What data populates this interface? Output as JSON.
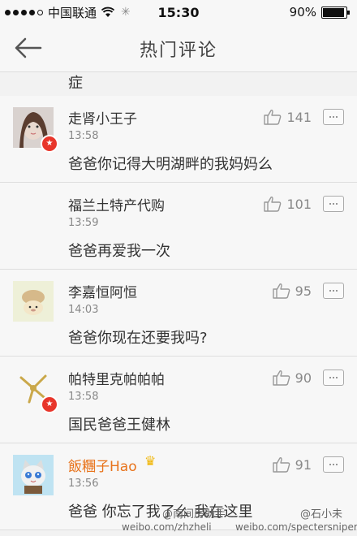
{
  "status_bar": {
    "carrier": "中国联通",
    "time": "15:30",
    "battery": "90%"
  },
  "header": {
    "title": "热门评论"
  },
  "partial_text": "症",
  "comments": [
    {
      "name": "走肾小王子",
      "time": "13:58",
      "text": "爸爸你记得大明湖畔的我妈妈么",
      "likes": "141",
      "name_color": "#333333"
    },
    {
      "name": "福兰土特产代购",
      "time": "13:59",
      "text": "爸爸再爱我一次",
      "likes": "101",
      "name_color": "#333333"
    },
    {
      "name": "李嘉恒阿恒",
      "time": "14:03",
      "text": "爸爸你现在还要我吗?",
      "likes": "95",
      "name_color": "#333333"
    },
    {
      "name": "帕特里克帕帕帕",
      "time": "13:58",
      "text": "国民爸爸王健林",
      "likes": "90",
      "name_color": "#333333"
    },
    {
      "name": "飯糰子Hao",
      "time": "13:56",
      "text": "爸爸 你忘了我了么 我在这里",
      "likes": "91",
      "name_color": "#e8731b"
    }
  ],
  "watermark": {
    "line1a": "@南间房助手",
    "line1b": "@石小未",
    "line2a": "weibo.com/zhzheli",
    "line2b": "weibo.com/spectersniper"
  }
}
